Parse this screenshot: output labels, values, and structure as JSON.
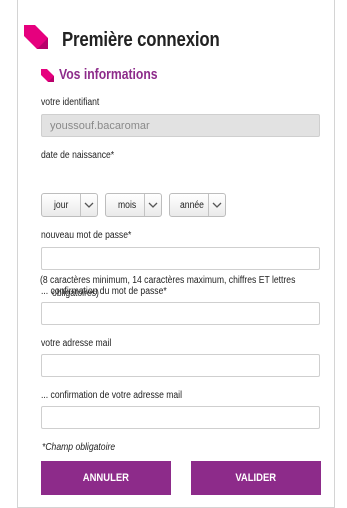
{
  "page": {
    "title": "Première connexion"
  },
  "section": {
    "title": "Vos informations"
  },
  "identifier": {
    "label": "votre identifiant",
    "value": "youssouf.bacaromar"
  },
  "birthdate": {
    "label": "date de naissance*",
    "day": "jour",
    "month": "mois",
    "year": "année"
  },
  "password": {
    "label": "nouveau mot de passe*",
    "value": "",
    "note_line1": "(8 caractères minimum, 14 caractères maximum, chiffres ET lettres",
    "note_line2": "obligatoires)"
  },
  "password_confirm": {
    "label": "... confirmation du mot de passe*",
    "value": ""
  },
  "email": {
    "label": "votre adresse mail",
    "value": ""
  },
  "email_confirm": {
    "label": "... confirmation de votre adresse mail",
    "value": ""
  },
  "required_note": "*Champ obligatoire",
  "buttons": {
    "cancel": "ANNULER",
    "submit": "VALIDER"
  },
  "colors": {
    "accent": "#8d2b8a",
    "arrow": "#e6007e",
    "readonly_bg": "#e2e2e2"
  },
  "icons": {
    "title": "pink-diagonal-arrow-icon",
    "section": "pink-diagonal-arrow-icon",
    "select": "chevron-down-icon"
  }
}
